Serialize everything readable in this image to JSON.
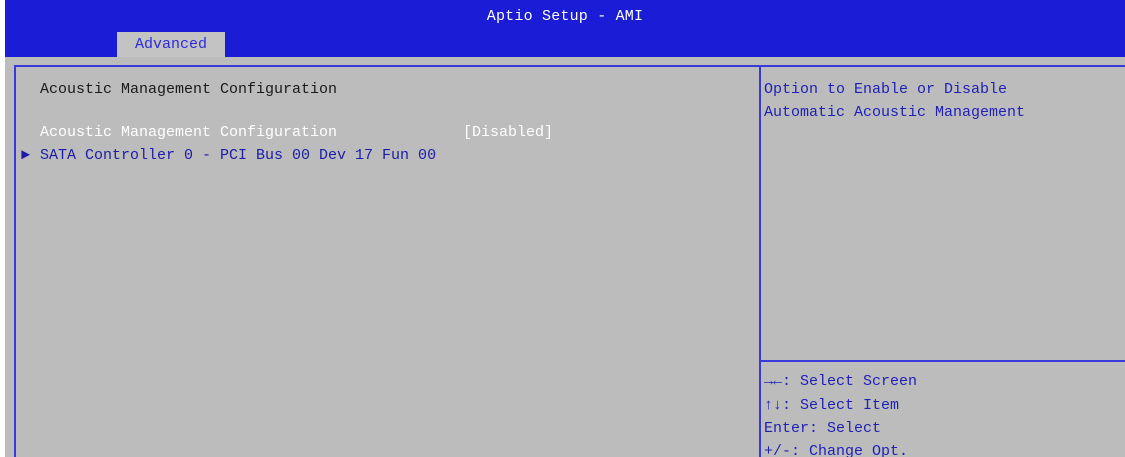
{
  "header": {
    "title": "Aptio Setup - AMI",
    "tabs": [
      {
        "label": "Advanced"
      }
    ]
  },
  "main": {
    "section_heading": "Acoustic Management Configuration",
    "setting": {
      "label": "Acoustic Management Configuration",
      "value": "[Disabled]"
    },
    "submenu": {
      "arrow": "►",
      "label": "SATA Controller 0 - PCI Bus 00 Dev 17 Fun 00"
    }
  },
  "help": {
    "lines": [
      "Option to Enable or Disable",
      "Automatic Acoustic Management"
    ],
    "key_hints": [
      "→←: Select Screen",
      "↑↓: Select Item",
      "Enter: Select",
      "+/-: Change Opt."
    ]
  },
  "colors": {
    "header_bg": "#1a1cd6",
    "panel_bg": "#bcbcbc",
    "frame": "#3a3ad8",
    "tab_bg": "#c3c3c3",
    "highlight_text": "#ffffff",
    "help_text": "#1f1fb8"
  }
}
